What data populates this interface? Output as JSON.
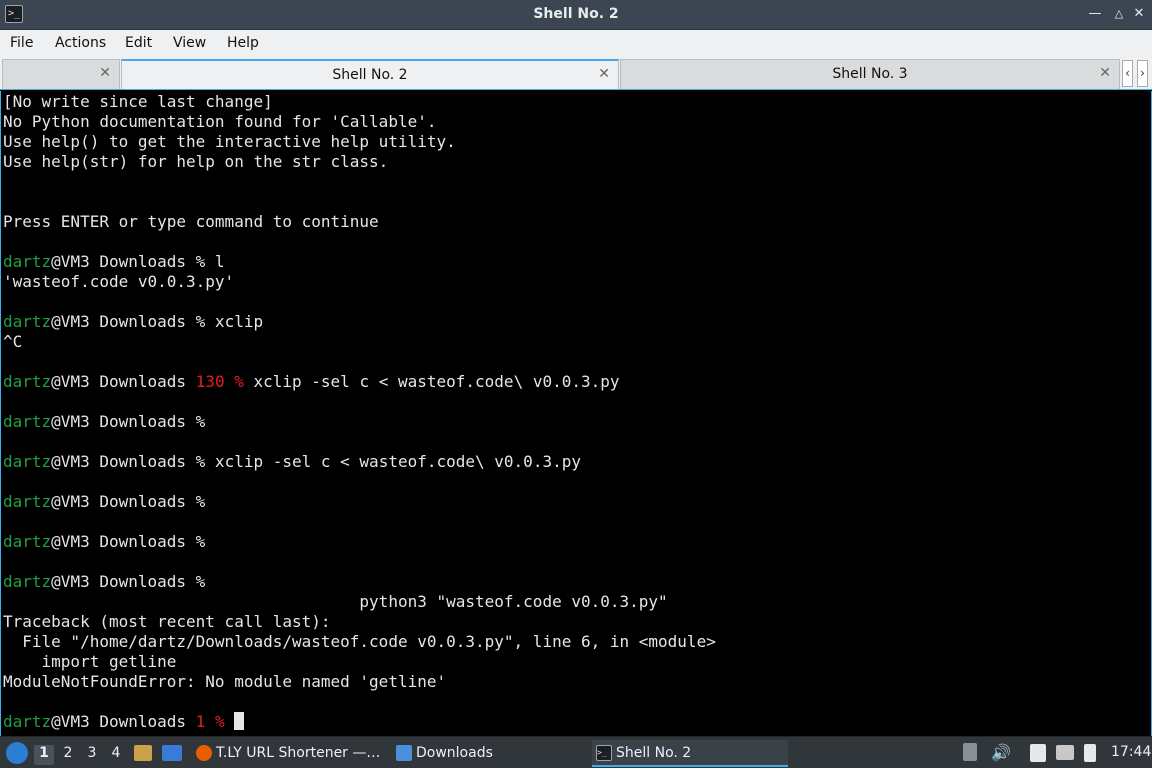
{
  "window": {
    "title": "Shell No. 2",
    "controls": [
      "minimize",
      "maximize",
      "close"
    ]
  },
  "menu": {
    "items": [
      "File",
      "Actions",
      "Edit",
      "View",
      "Help"
    ]
  },
  "tabs": [
    {
      "label": "",
      "active": false
    },
    {
      "label": "Shell No. 2",
      "active": true
    },
    {
      "label": "Shell No. 3",
      "active": false
    }
  ],
  "terminal": {
    "lines": [
      "[No write since last change]",
      "No Python documentation found for 'Callable'.",
      "Use help() to get the interactive help utility.",
      "Use help(str) for help on the str class.",
      "",
      "",
      "Press ENTER or type command to continue",
      "",
      "dartz@VM3 Downloads % l",
      "'wasteof.code v0.0.3.py'",
      "",
      "dartz@VM3 Downloads % xclip",
      "^C",
      "",
      "dartz@VM3 Downloads 130 % xclip -sel c < wasteof.code\\ v0.0.3.py",
      "",
      "dartz@VM3 Downloads %",
      "",
      "dartz@VM3 Downloads % xclip -sel c < wasteof.code\\ v0.0.3.py",
      "",
      "dartz@VM3 Downloads %",
      "",
      "dartz@VM3 Downloads %",
      "",
      "dartz@VM3 Downloads %",
      "                                     python3 \"wasteof.code v0.0.3.py\"",
      "Traceback (most recent call last):",
      "  File \"/home/dartz/Downloads/wasteof.code v0.0.3.py\", line 6, in <module>",
      "    import getline",
      "ModuleNotFoundError: No module named 'getline'",
      "",
      "dartz@VM3 Downloads 1 % "
    ],
    "prompt_user": "dartz",
    "prompt_rest": "@VM3 Downloads",
    "prompt_color": "#20a040",
    "error_status_color": "#e02020",
    "background": "#000000",
    "foreground": "#e6e6e6"
  },
  "taskbar": {
    "workspaces": [
      "1",
      "2",
      "3",
      "4"
    ],
    "active_workspace": "1",
    "tasks": [
      {
        "label": "T.LY URL Shortener —…",
        "icon": "firefox-icon"
      },
      {
        "label": "Downloads",
        "icon": "folder-icon"
      },
      {
        "label": "Shell No. 2",
        "icon": "terminal-icon",
        "active": true
      }
    ],
    "clock": "17:44"
  }
}
